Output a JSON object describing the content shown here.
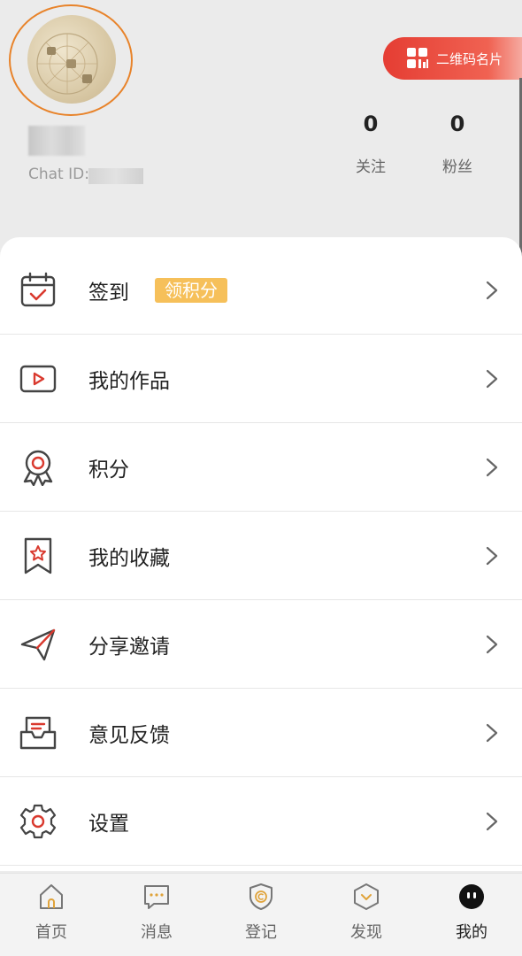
{
  "profile": {
    "chat_id_label": "Chat ID:",
    "qr_button_label": "二维码名片",
    "stats": [
      {
        "value": "0",
        "label": "关注"
      },
      {
        "value": "0",
        "label": "粉丝"
      }
    ]
  },
  "menu": {
    "items": [
      {
        "label": "签到",
        "badge": "领积分",
        "icon": "calendar-check-icon"
      },
      {
        "label": "我的作品",
        "icon": "video-play-icon"
      },
      {
        "label": "积分",
        "icon": "medal-icon"
      },
      {
        "label": "我的收藏",
        "icon": "bookmark-star-icon"
      },
      {
        "label": "分享邀请",
        "icon": "paper-plane-icon"
      },
      {
        "label": "意见反馈",
        "icon": "feedback-inbox-icon"
      },
      {
        "label": "设置",
        "icon": "gear-icon"
      }
    ]
  },
  "tabbar": {
    "tabs": [
      {
        "label": "首页",
        "icon": "home-icon"
      },
      {
        "label": "消息",
        "icon": "message-icon"
      },
      {
        "label": "登记",
        "icon": "register-shield-icon"
      },
      {
        "label": "发现",
        "icon": "discover-icon"
      },
      {
        "label": "我的",
        "icon": "profile-face-icon"
      }
    ],
    "active": "我的"
  },
  "colors": {
    "accent_red": "#e53d33",
    "icon_red": "#d9392e",
    "badge_yellow": "#f6c05a",
    "avatar_ring": "#e8832a"
  }
}
